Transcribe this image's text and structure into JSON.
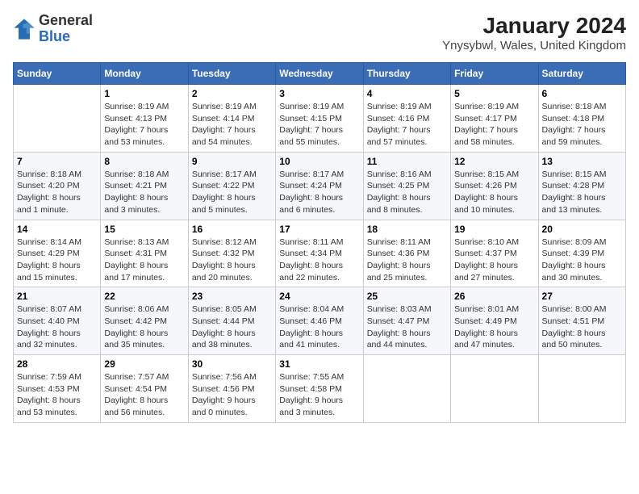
{
  "logo": {
    "general": "General",
    "blue": "Blue"
  },
  "title": "January 2024",
  "subtitle": "Ynysybwl, Wales, United Kingdom",
  "days_of_week": [
    "Sunday",
    "Monday",
    "Tuesday",
    "Wednesday",
    "Thursday",
    "Friday",
    "Saturday"
  ],
  "weeks": [
    [
      {
        "day": "",
        "info": ""
      },
      {
        "day": "1",
        "info": "Sunrise: 8:19 AM\nSunset: 4:13 PM\nDaylight: 7 hours\nand 53 minutes."
      },
      {
        "day": "2",
        "info": "Sunrise: 8:19 AM\nSunset: 4:14 PM\nDaylight: 7 hours\nand 54 minutes."
      },
      {
        "day": "3",
        "info": "Sunrise: 8:19 AM\nSunset: 4:15 PM\nDaylight: 7 hours\nand 55 minutes."
      },
      {
        "day": "4",
        "info": "Sunrise: 8:19 AM\nSunset: 4:16 PM\nDaylight: 7 hours\nand 57 minutes."
      },
      {
        "day": "5",
        "info": "Sunrise: 8:19 AM\nSunset: 4:17 PM\nDaylight: 7 hours\nand 58 minutes."
      },
      {
        "day": "6",
        "info": "Sunrise: 8:18 AM\nSunset: 4:18 PM\nDaylight: 7 hours\nand 59 minutes."
      }
    ],
    [
      {
        "day": "7",
        "info": "Sunrise: 8:18 AM\nSunset: 4:20 PM\nDaylight: 8 hours\nand 1 minute."
      },
      {
        "day": "8",
        "info": "Sunrise: 8:18 AM\nSunset: 4:21 PM\nDaylight: 8 hours\nand 3 minutes."
      },
      {
        "day": "9",
        "info": "Sunrise: 8:17 AM\nSunset: 4:22 PM\nDaylight: 8 hours\nand 5 minutes."
      },
      {
        "day": "10",
        "info": "Sunrise: 8:17 AM\nSunset: 4:24 PM\nDaylight: 8 hours\nand 6 minutes."
      },
      {
        "day": "11",
        "info": "Sunrise: 8:16 AM\nSunset: 4:25 PM\nDaylight: 8 hours\nand 8 minutes."
      },
      {
        "day": "12",
        "info": "Sunrise: 8:15 AM\nSunset: 4:26 PM\nDaylight: 8 hours\nand 10 minutes."
      },
      {
        "day": "13",
        "info": "Sunrise: 8:15 AM\nSunset: 4:28 PM\nDaylight: 8 hours\nand 13 minutes."
      }
    ],
    [
      {
        "day": "14",
        "info": "Sunrise: 8:14 AM\nSunset: 4:29 PM\nDaylight: 8 hours\nand 15 minutes."
      },
      {
        "day": "15",
        "info": "Sunrise: 8:13 AM\nSunset: 4:31 PM\nDaylight: 8 hours\nand 17 minutes."
      },
      {
        "day": "16",
        "info": "Sunrise: 8:12 AM\nSunset: 4:32 PM\nDaylight: 8 hours\nand 20 minutes."
      },
      {
        "day": "17",
        "info": "Sunrise: 8:11 AM\nSunset: 4:34 PM\nDaylight: 8 hours\nand 22 minutes."
      },
      {
        "day": "18",
        "info": "Sunrise: 8:11 AM\nSunset: 4:36 PM\nDaylight: 8 hours\nand 25 minutes."
      },
      {
        "day": "19",
        "info": "Sunrise: 8:10 AM\nSunset: 4:37 PM\nDaylight: 8 hours\nand 27 minutes."
      },
      {
        "day": "20",
        "info": "Sunrise: 8:09 AM\nSunset: 4:39 PM\nDaylight: 8 hours\nand 30 minutes."
      }
    ],
    [
      {
        "day": "21",
        "info": "Sunrise: 8:07 AM\nSunset: 4:40 PM\nDaylight: 8 hours\nand 32 minutes."
      },
      {
        "day": "22",
        "info": "Sunrise: 8:06 AM\nSunset: 4:42 PM\nDaylight: 8 hours\nand 35 minutes."
      },
      {
        "day": "23",
        "info": "Sunrise: 8:05 AM\nSunset: 4:44 PM\nDaylight: 8 hours\nand 38 minutes."
      },
      {
        "day": "24",
        "info": "Sunrise: 8:04 AM\nSunset: 4:46 PM\nDaylight: 8 hours\nand 41 minutes."
      },
      {
        "day": "25",
        "info": "Sunrise: 8:03 AM\nSunset: 4:47 PM\nDaylight: 8 hours\nand 44 minutes."
      },
      {
        "day": "26",
        "info": "Sunrise: 8:01 AM\nSunset: 4:49 PM\nDaylight: 8 hours\nand 47 minutes."
      },
      {
        "day": "27",
        "info": "Sunrise: 8:00 AM\nSunset: 4:51 PM\nDaylight: 8 hours\nand 50 minutes."
      }
    ],
    [
      {
        "day": "28",
        "info": "Sunrise: 7:59 AM\nSunset: 4:53 PM\nDaylight: 8 hours\nand 53 minutes."
      },
      {
        "day": "29",
        "info": "Sunrise: 7:57 AM\nSunset: 4:54 PM\nDaylight: 8 hours\nand 56 minutes."
      },
      {
        "day": "30",
        "info": "Sunrise: 7:56 AM\nSunset: 4:56 PM\nDaylight: 9 hours\nand 0 minutes."
      },
      {
        "day": "31",
        "info": "Sunrise: 7:55 AM\nSunset: 4:58 PM\nDaylight: 9 hours\nand 3 minutes."
      },
      {
        "day": "",
        "info": ""
      },
      {
        "day": "",
        "info": ""
      },
      {
        "day": "",
        "info": ""
      }
    ]
  ]
}
